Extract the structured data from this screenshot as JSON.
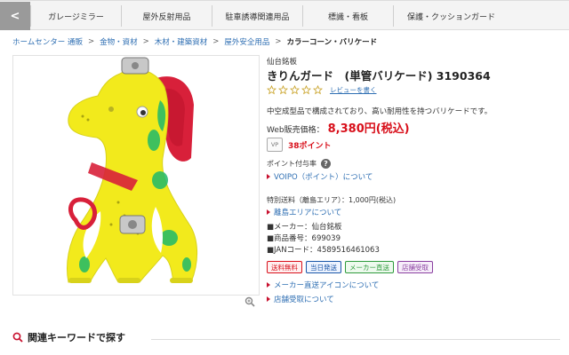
{
  "category_tabs": {
    "prev_arrow": "<",
    "items": [
      {
        "label": "ガレージミラー"
      },
      {
        "label": "屋外反射用品"
      },
      {
        "label": "駐車誘導関連用品"
      },
      {
        "label": "標識・看板"
      },
      {
        "label": "保護・クッションガード"
      }
    ]
  },
  "breadcrumb": {
    "items": [
      {
        "label": "ホームセンター 通販"
      },
      {
        "label": "金物・資材"
      },
      {
        "label": "木材・建築資材"
      },
      {
        "label": "屋外安全用品"
      }
    ],
    "separator": ">",
    "current": "カラーコーン・バリケード"
  },
  "product": {
    "brand": "仙台銘板",
    "title": "きりんガード　(単管バリケード)  3190364",
    "review_link": "レビューを書く",
    "rating_stars": 0,
    "description": "中空成型品で構成されており、高い耐用性を持つバリケードです。",
    "price_label": "Web販売価格：",
    "price": "8,380円(税込)",
    "vp_icon_text": "VP",
    "points": "38ポイント",
    "point_rate_label": "ポイント付与率",
    "help_icon": "?",
    "voipo_link": "VOIPO（ポイント）について",
    "shipping": "特別送料（離島エリア）：1,000円(税込)",
    "remote_link": "離島エリアについて",
    "specs": [
      {
        "text": "■メーカー：仙台銘板"
      },
      {
        "text": "■商品番号：699039"
      },
      {
        "text": "■JANコード：4589516461063"
      }
    ],
    "badges": [
      {
        "label": "送料無料",
        "color": "#d8101b",
        "bg": "#fff0f0"
      },
      {
        "label": "当日発送",
        "color": "#1a56a8",
        "bg": "#eef4ff"
      },
      {
        "label": "メーカー直送",
        "color": "#2e9b3c",
        "bg": "#eefaee"
      },
      {
        "label": "店舗受取",
        "color": "#8a3fa0",
        "bg": "#f7eefa"
      }
    ],
    "maker_icon_link": "メーカー直送アイコンについて",
    "store_link": "店舗受取について"
  },
  "related": {
    "title": "関連キーワードで探す"
  },
  "colors": {
    "accent_red": "#d8101b",
    "link_blue": "#2f6fb3",
    "giraffe_yellow": "#f2ea1c",
    "giraffe_red": "#d8203a",
    "giraffe_green": "#1fb86a"
  },
  "icons": {
    "zoom": "magnifier-zoom-icon",
    "search": "search-icon",
    "star": "star-outline-icon",
    "triangle": "triangle-right-icon"
  }
}
